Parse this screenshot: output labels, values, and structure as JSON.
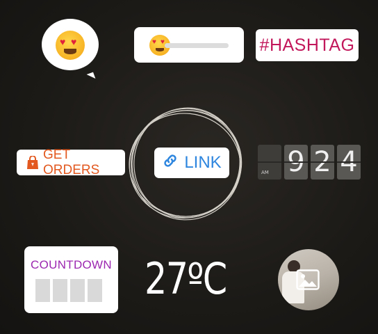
{
  "stickers": {
    "emoji_bubble": {
      "icon": "heart-eyes-emoji"
    },
    "slider": {
      "icon": "heart-eyes-emoji"
    },
    "hashtag": {
      "label": "#HASHTAG"
    },
    "get_orders": {
      "label": "GET ORDERS",
      "icon": "shopping-bag-icon"
    },
    "link": {
      "label": "LINK",
      "icon": "link-icon"
    },
    "clock": {
      "ampm": "AM",
      "digits": [
        "9",
        "2",
        "4"
      ]
    },
    "countdown": {
      "label": "COUNTDOWN"
    },
    "temperature": {
      "label": "27ºC"
    },
    "photo": {
      "icon": "image-icon"
    }
  },
  "colors": {
    "background": "#1b1a18",
    "hashtag": "#c2185b",
    "get_orders": "#e2581f",
    "link": "#2e86de",
    "countdown": "#9c27b0"
  }
}
